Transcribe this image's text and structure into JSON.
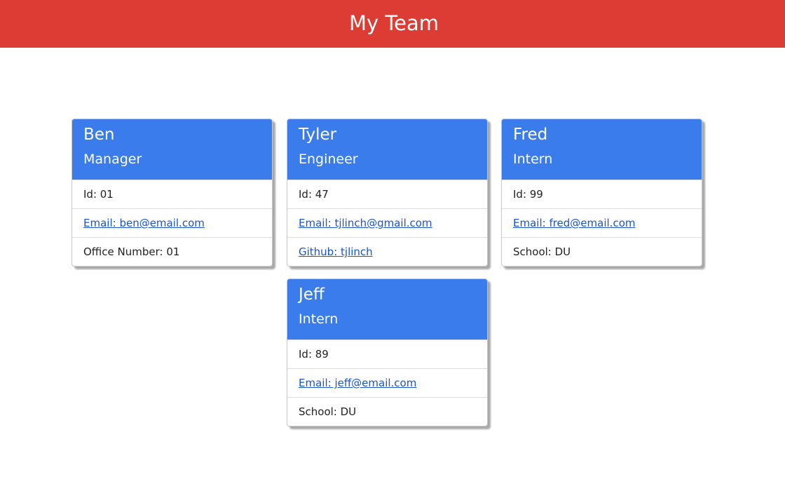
{
  "header": {
    "title": "My Team"
  },
  "cards": [
    {
      "name": "Ben",
      "role": "Manager",
      "id_text": "Id: 01",
      "email_text": "Email: ben@email.com",
      "extra_text": "Office Number: 01"
    },
    {
      "name": "Tyler",
      "role": "Engineer",
      "id_text": "Id: 47",
      "email_text": "Email: tjlinch@gmail.com",
      "extra_text": "Github: tjlinch"
    },
    {
      "name": "Fred",
      "role": "Intern",
      "id_text": "Id: 99",
      "email_text": "Email: fred@email.com",
      "extra_text": "School: DU"
    },
    {
      "name": "Jeff",
      "role": "Intern",
      "id_text": "Id: 89",
      "email_text": "Email: jeff@email.com",
      "extra_text": "School: DU"
    }
  ],
  "colors": {
    "header_bg": "#dc3c33",
    "card_head_bg": "#3b7cec",
    "link": "#1a55c8"
  }
}
